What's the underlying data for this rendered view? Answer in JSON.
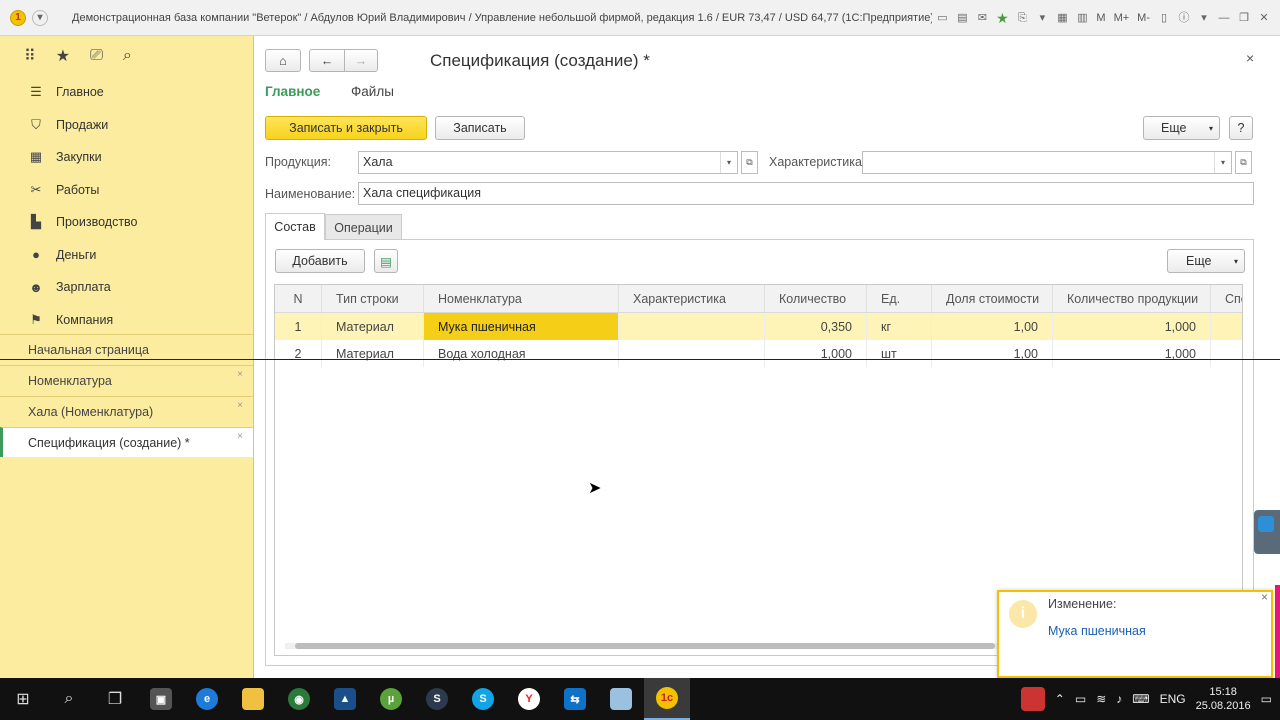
{
  "window": {
    "title": "Демонстрационная база компании \"Ветерок\" / Абдулов Юрий Владимирович / Управление небольшой фирмой, редакция 1.6 / EUR 73,47 / USD 64,77  (1С:Предприятие)",
    "menu_buttons": [
      "M",
      "M+",
      "M-"
    ]
  },
  "sidebar": {
    "items": [
      {
        "label": "Главное",
        "icon": "menu-icon"
      },
      {
        "label": "Продажи",
        "icon": "basket-icon"
      },
      {
        "label": "Закупки",
        "icon": "cart-icon"
      },
      {
        "label": "Работы",
        "icon": "tools-icon"
      },
      {
        "label": "Производство",
        "icon": "factory-icon"
      },
      {
        "label": "Деньги",
        "icon": "money-icon"
      },
      {
        "label": "Зарплата",
        "icon": "people-icon"
      },
      {
        "label": "Компания",
        "icon": "flag-icon"
      }
    ],
    "open_windows": [
      {
        "label": "Начальная страница"
      },
      {
        "label": "Номенклатура"
      },
      {
        "label": "Хала (Номенклатура)"
      },
      {
        "label": "Спецификация (создание) *"
      }
    ]
  },
  "form": {
    "title": "Спецификация (создание) *",
    "tabs_top": [
      "Главное",
      "Файлы"
    ],
    "save_close_label": "Записать и закрыть",
    "save_label": "Записать",
    "more_label": "Еще",
    "help_label": "?",
    "product_label": "Продукция:",
    "product_value": "Хала",
    "characteristic_label": "Характеристика:",
    "characteristic_value": "",
    "name_label": "Наименование:",
    "name_value": "Хала спецификация",
    "inner_tabs": [
      "Состав",
      "Операции"
    ],
    "add_label": "Добавить",
    "grid_more_label": "Еще",
    "columns": [
      "N",
      "Тип строки",
      "Номенклатура",
      "Характеристика",
      "Количество",
      "Ед.",
      "Доля стоимости",
      "Количество продукции",
      "Спе"
    ],
    "rows": [
      [
        "1",
        "Материал",
        "Мука пшеничная",
        "",
        "0,350",
        "кг",
        "1,00",
        "1,000"
      ],
      [
        "2",
        "Материал",
        "Вода холодная",
        "",
        "1,000",
        "шт",
        "1,00",
        "1,000"
      ]
    ]
  },
  "notification": {
    "title": "Изменение:",
    "link": "Мука пшеничная"
  },
  "taskbar": {
    "lang": "ENG",
    "time": "15:18",
    "date": "25.08.2016"
  },
  "colors": {
    "sidebar_bg": "#fbeca0",
    "accent_green": "#3a9b5d",
    "button_yellow": "#f7d21c",
    "row_selected": "#fff4b8",
    "cell_selected": "#f5cf17"
  }
}
